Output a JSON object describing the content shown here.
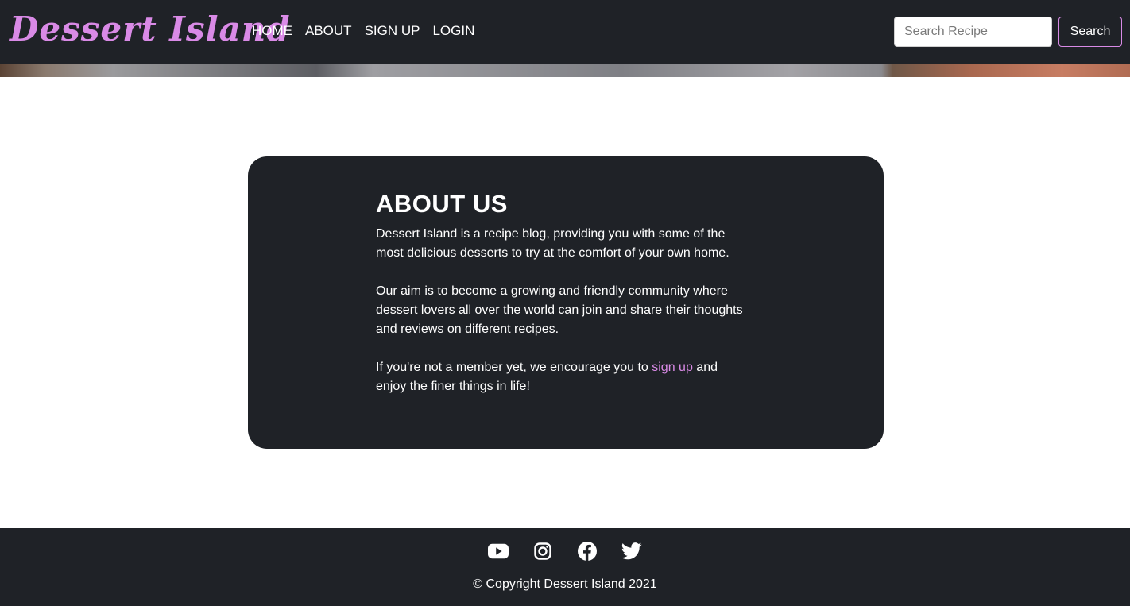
{
  "header": {
    "brand": "Dessert Island",
    "nav": [
      "HOME",
      "ABOUT",
      "SIGN UP",
      "LOGIN"
    ],
    "search": {
      "placeholder": "Search Recipe",
      "value": "",
      "button": "Search"
    }
  },
  "about": {
    "title": "ABOUT US",
    "paragraph1": "Dessert Island is a recipe blog, providing you with some of the most delicious desserts to try at the comfort of your own home.",
    "paragraph2": "Our aim is to become a growing and friendly community where dessert lovers all over the world can join and share their thoughts and reviews on different recipes.",
    "paragraph3_before": "If you're not a member yet, we encourage you to ",
    "paragraph3_link": "sign up",
    "paragraph3_after": " and enjoy the finer things in life!"
  },
  "footer": {
    "social_icons": [
      "youtube-icon",
      "instagram-icon",
      "facebook-icon",
      "twitter-icon"
    ],
    "copyright": "© Copyright Dessert Island 2021"
  },
  "colors": {
    "accent": "#d98ae6",
    "dark": "#1f2227",
    "background": "#ffffff"
  }
}
